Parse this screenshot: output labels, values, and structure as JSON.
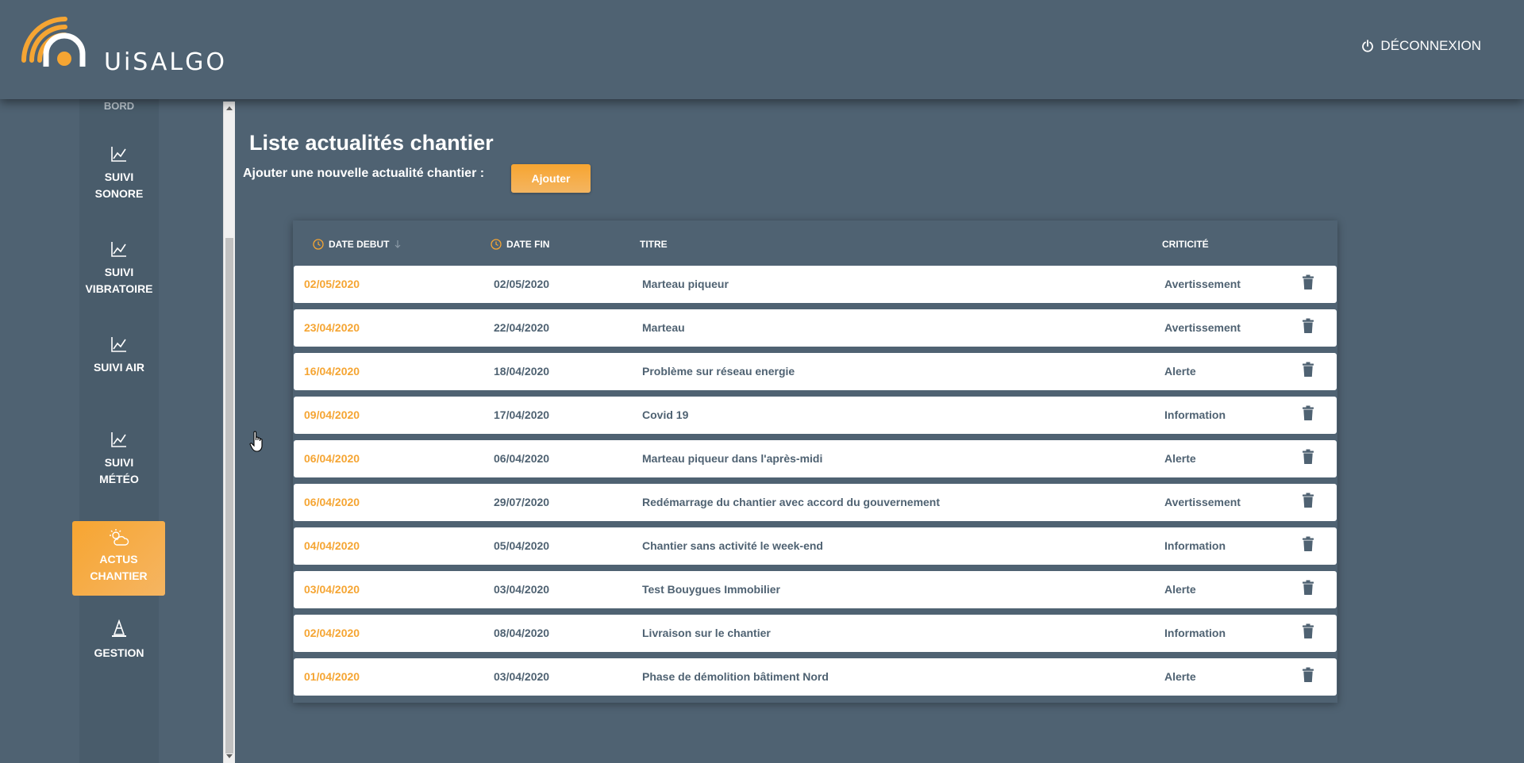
{
  "header": {
    "logo_text": "UiSALGO",
    "logout_label": "DÉCONNEXION"
  },
  "sidebar": {
    "items": [
      {
        "line1": "BORD",
        "line2": "",
        "icon": "chart-line-icon"
      },
      {
        "line1": "SUIVI",
        "line2": "SONORE",
        "icon": "chart-line-icon"
      },
      {
        "line1": "SUIVI",
        "line2": "VIBRATOIRE",
        "icon": "chart-line-icon"
      },
      {
        "line1": "SUIVI AIR",
        "line2": "",
        "icon": "chart-line-icon"
      },
      {
        "line1": "SUIVI",
        "line2": "MÉTÉO",
        "icon": "chart-line-icon"
      },
      {
        "line1": "ACTUS",
        "line2": "CHANTIER",
        "icon": "weather-cloud-sun-icon",
        "active": true
      },
      {
        "line1": "GESTION",
        "line2": "",
        "icon": "cone-icon"
      }
    ]
  },
  "main": {
    "title": "Liste actualités chantier",
    "add_label": "Ajouter une nouvelle actualité chantier :",
    "add_button": "Ajouter"
  },
  "table": {
    "columns": {
      "start": "DATE DEBUT",
      "end": "DATE FIN",
      "title": "TITRE",
      "criticality": "CRITICITÉ"
    },
    "rows": [
      {
        "start": "02/05/2020",
        "end": "02/05/2020",
        "title": "Marteau piqueur",
        "criticality": "Avertissement"
      },
      {
        "start": "23/04/2020",
        "end": "22/04/2020",
        "title": "Marteau",
        "criticality": "Avertissement"
      },
      {
        "start": "16/04/2020",
        "end": "18/04/2020",
        "title": "Problème sur réseau energie",
        "criticality": "Alerte"
      },
      {
        "start": "09/04/2020",
        "end": "17/04/2020",
        "title": "Covid 19",
        "criticality": "Information"
      },
      {
        "start": "06/04/2020",
        "end": "06/04/2020",
        "title": "Marteau piqueur dans l'après-midi",
        "criticality": "Alerte"
      },
      {
        "start": "06/04/2020",
        "end": "29/07/2020",
        "title": "Redémarrage du chantier avec accord du gouvernement",
        "criticality": "Avertissement"
      },
      {
        "start": "04/04/2020",
        "end": "05/04/2020",
        "title": "Chantier sans activité le week-end",
        "criticality": "Information"
      },
      {
        "start": "03/04/2020",
        "end": "03/04/2020",
        "title": "Test Bouygues Immobilier",
        "criticality": "Alerte"
      },
      {
        "start": "02/04/2020",
        "end": "08/04/2020",
        "title": "Livraison sur le chantier",
        "criticality": "Information"
      },
      {
        "start": "01/04/2020",
        "end": "03/04/2020",
        "title": "Phase de démolition bâtiment Nord",
        "criticality": "Alerte"
      }
    ]
  },
  "colors": {
    "background": "#4f6272",
    "accent": "#f5a533",
    "row_bg": "#ffffff"
  }
}
